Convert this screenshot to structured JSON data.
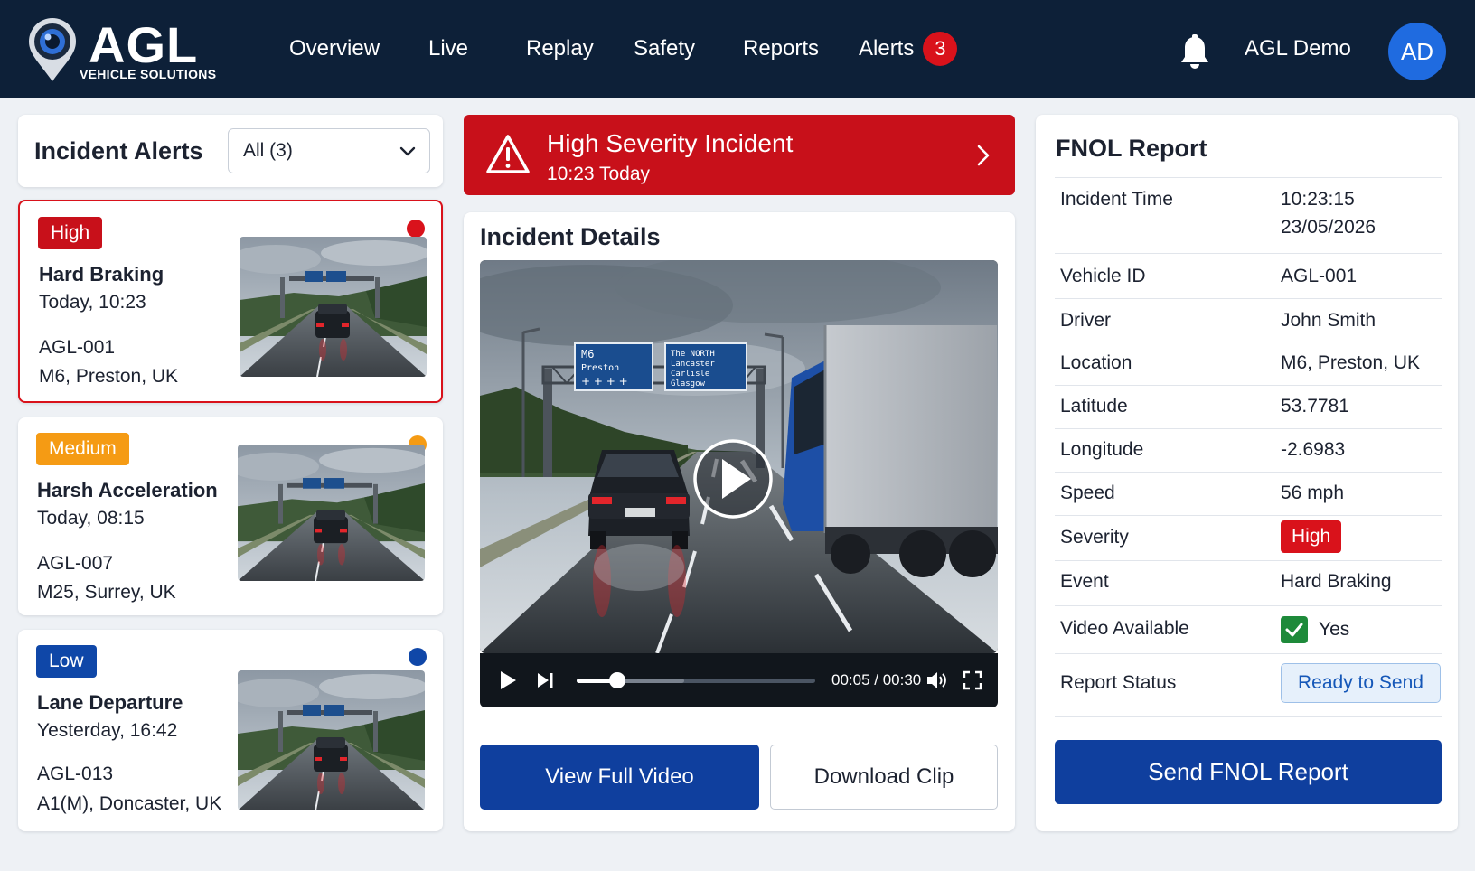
{
  "brand": {
    "name": "AGL",
    "tagline": "VEHICLE SOLUTIONS"
  },
  "nav": {
    "items": [
      {
        "label": "Overview"
      },
      {
        "label": "Live"
      },
      {
        "label": "Replay"
      },
      {
        "label": "Safety"
      },
      {
        "label": "Reports"
      },
      {
        "label": "Alerts",
        "badge": "3"
      }
    ]
  },
  "user": {
    "name": "AGL Demo",
    "initials": "AD"
  },
  "icons": [
    "bell-icon",
    "chevron-down-icon",
    "warning-triangle-icon",
    "chevron-right-icon",
    "play-icon",
    "skip-forward-icon",
    "volume-icon",
    "fullscreen-icon",
    "checkmark-icon"
  ],
  "colors": {
    "navy": "#0d2038",
    "high": "#d9121b",
    "medium": "#f59b14",
    "low": "#0f47a8",
    "primary": "#0f3f9e",
    "success": "#1e8a3a"
  },
  "alerts_panel": {
    "title": "Incident Alerts",
    "filter_value": "All (3)"
  },
  "alerts": [
    {
      "severity": "High",
      "severity_color": "#c8101a",
      "dot_color": "#d9121b",
      "title": "Hard Braking",
      "time": "Today, 10:23",
      "vehicle": "AGL-001",
      "location": "M6, Preston, UK"
    },
    {
      "severity": "Medium",
      "severity_color": "#f59b14",
      "dot_color": "#f59b14",
      "title": "Harsh Acceleration",
      "time": "Today, 08:15",
      "vehicle": "AGL-007",
      "location": "M25, Surrey, UK"
    },
    {
      "severity": "Low",
      "severity_color": "#0f47a8",
      "dot_color": "#0f47a8",
      "title": "Lane Departure",
      "time": "Yesterday, 16:42",
      "vehicle": "AGL-013",
      "location": "A1(M), Doncaster, UK"
    }
  ],
  "banner": {
    "title": "High Severity Incident",
    "subtitle": "10:23 Today"
  },
  "details": {
    "title": "Incident Details",
    "video": {
      "sign_left": {
        "road": "M6",
        "dest": "Preston"
      },
      "sign_right": {
        "line1": "The NORTH",
        "line2": "Lancaster",
        "line3": "Carlisle",
        "line4": "Glasgow"
      },
      "time_readout": "00:05 / 00:30",
      "progress": 0.17,
      "buffered": 0.45
    },
    "view_full_video": "View Full Video",
    "download_clip": "Download Clip"
  },
  "fnol": {
    "title": "FNOL Report",
    "rows": {
      "incident_time": {
        "label": "Incident Time",
        "value_line1": "10:23:15",
        "value_line2": "23/05/2026"
      },
      "vehicle_id": {
        "label": "Vehicle ID",
        "value": "AGL-001"
      },
      "driver": {
        "label": "Driver",
        "value": "John Smith"
      },
      "location": {
        "label": "Location",
        "value": "M6, Preston, UK"
      },
      "latitude": {
        "label": "Latitude",
        "value": "53.7781"
      },
      "longitude": {
        "label": "Longitude",
        "value": "-2.6983"
      },
      "speed": {
        "label": "Speed",
        "value": "56 mph"
      },
      "severity": {
        "label": "Severity",
        "value": "High"
      },
      "event": {
        "label": "Event",
        "value": "Hard Braking"
      },
      "video_available": {
        "label": "Video Available",
        "value": "Yes",
        "checked": true
      },
      "report_status": {
        "label": "Report Status",
        "value": "Ready to Send"
      }
    },
    "send_button": "Send FNOL Report"
  }
}
